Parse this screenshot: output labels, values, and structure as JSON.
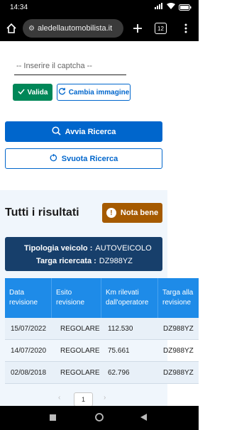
{
  "status_bar": {
    "time": "14:34",
    "battery": "87"
  },
  "browser": {
    "url": "aledellautomobilista.it",
    "tab_count": "12"
  },
  "captcha": {
    "placeholder": "-- Inserire il captcha --"
  },
  "buttons": {
    "valida": "Valida",
    "cambia_immagine": "Cambia immagine",
    "avvia_ricerca": "Avvia Ricerca",
    "svuota_ricerca": "Svuota Ricerca",
    "nota_bene": "Nota bene"
  },
  "results": {
    "title": "Tutti i risultati",
    "info": {
      "tipologia_label": "Tipologia veicolo :",
      "tipologia_value": "AUTOVEICOLO",
      "targa_label": "Targa ricercata :",
      "targa_value": "DZ988YZ"
    },
    "table": {
      "headers": [
        "Data revisione",
        "Esito revisione",
        "Km rilevati dall'operatore",
        "Targa alla revisione"
      ],
      "rows": [
        [
          "15/07/2022",
          "REGOLARE",
          "112.530",
          "DZ988YZ"
        ],
        [
          "14/07/2020",
          "REGOLARE",
          "75.661",
          "DZ988YZ"
        ],
        [
          "02/08/2018",
          "REGOLARE",
          "62.796",
          "DZ988YZ"
        ]
      ]
    },
    "pagination": {
      "current_page": "1"
    }
  },
  "colors": {
    "primary": "#0066cc",
    "success": "#008758",
    "warning": "#a55a00",
    "info_box": "#173f6b",
    "table_header": "#1e8be8"
  }
}
